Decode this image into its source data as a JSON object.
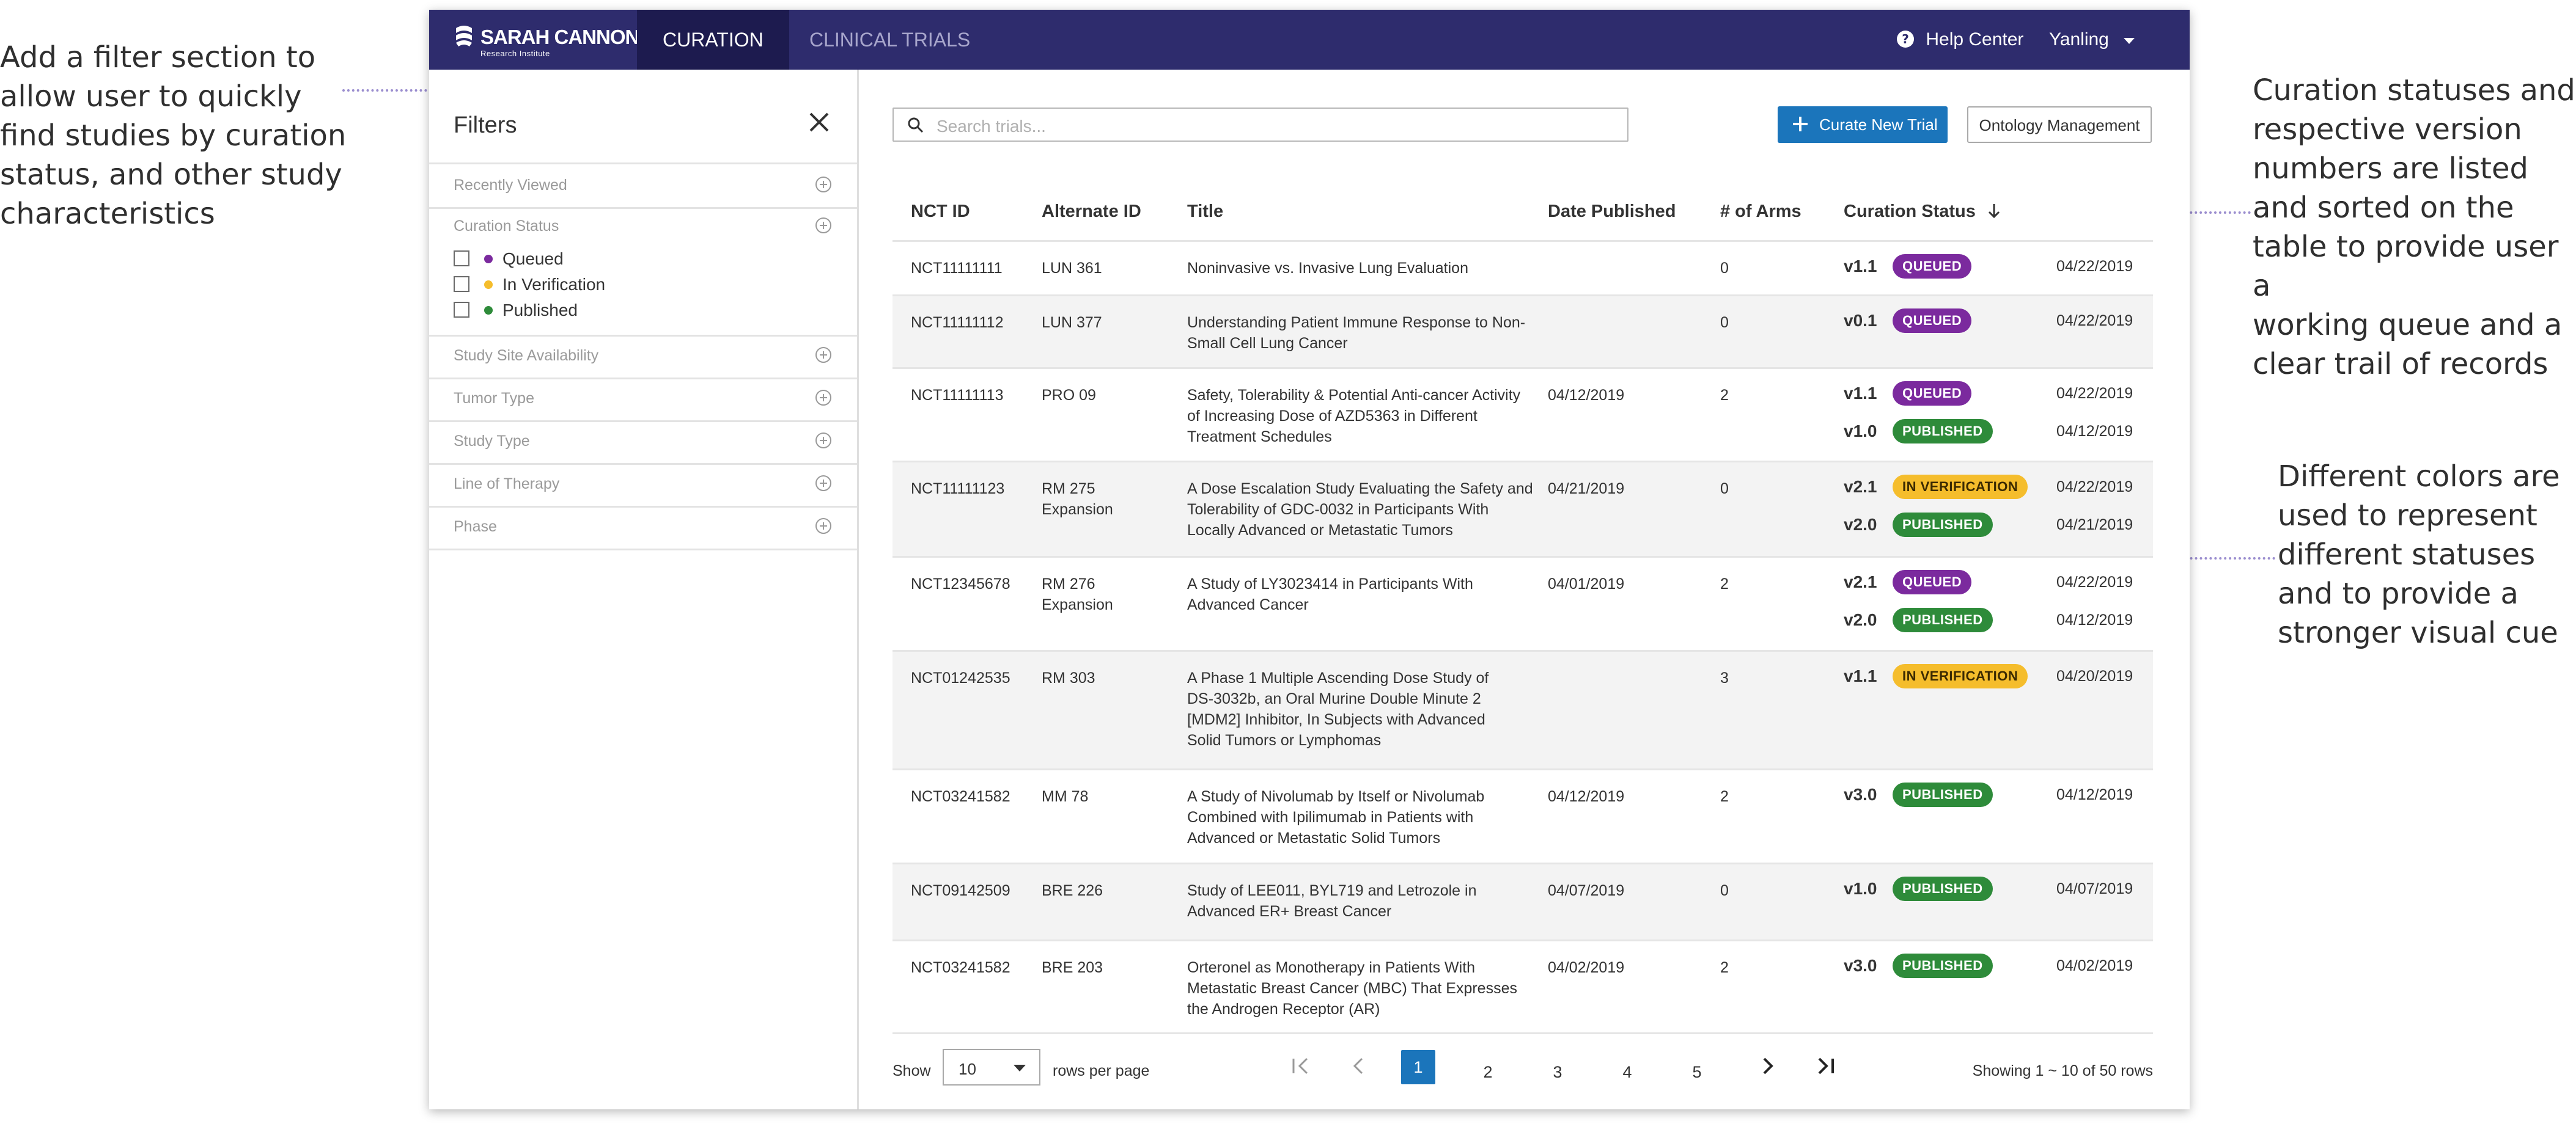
{
  "annotations": {
    "left": "Add a filter section to\nallow user to quickly\nfind studies by curation\nstatus, and other study\ncharacteristics",
    "right_top": "Curation statuses and\nrespective version\nnumbers are listed\nand sorted on the\ntable to provide user a\nworking queue and a\nclear trail of records",
    "right_bottom": "Different colors are\nused to represent\ndifferent statuses\nand to provide a\nstronger visual cue"
  },
  "brand": {
    "name": "SARAH CANNON",
    "sub": "Research Institute"
  },
  "nav": {
    "tabs": [
      {
        "label": "CURATION",
        "active": true
      },
      {
        "label": "CLINICAL TRIALS",
        "active": false
      }
    ],
    "help": "Help Center",
    "user": "Yanling"
  },
  "filters": {
    "title": "Filters",
    "sections": [
      "Recently Viewed",
      "Curation Status",
      "Study Site Availability",
      "Tumor Type",
      "Study Type",
      "Line of Therapy",
      "Phase"
    ],
    "curation_options": [
      {
        "label": "Queued",
        "color": "#7b2a9e"
      },
      {
        "label": "In Verification",
        "color": "#f5bd2c"
      },
      {
        "label": "Published",
        "color": "#2e8b3a"
      }
    ]
  },
  "toolbar": {
    "search_placeholder": "Search trials...",
    "curate_label": "Curate New Trial",
    "ontology_label": "Ontology Management"
  },
  "table": {
    "headers": [
      "NCT ID",
      "Alternate ID",
      "Title",
      "Date Published",
      "# of Arms",
      "Curation Status"
    ],
    "rows": [
      {
        "nct": "NCT11111111",
        "alt": "LUN 361",
        "title": "Noninvasive vs. Invasive Lung Evaluation",
        "published": "",
        "arms": "0",
        "versions": [
          {
            "v": "v1.1",
            "status": "QUEUED",
            "date": "04/22/2019"
          }
        ]
      },
      {
        "nct": "NCT11111112",
        "alt": "LUN 377",
        "title": "Understanding Patient Immune Response to Non-Small Cell Lung Cancer",
        "published": "",
        "arms": "0",
        "versions": [
          {
            "v": "v0.1",
            "status": "QUEUED",
            "date": "04/22/2019"
          }
        ]
      },
      {
        "nct": "NCT11111113",
        "alt": "PRO 09",
        "title": "Safety, Tolerability & Potential Anti-cancer Activity of Increasing Dose of AZD5363 in Different Treatment Schedules",
        "published": "04/12/2019",
        "arms": "2",
        "versions": [
          {
            "v": "v1.1",
            "status": "QUEUED",
            "date": "04/22/2019"
          },
          {
            "v": "v1.0",
            "status": "PUBLISHED",
            "date": "04/12/2019"
          }
        ]
      },
      {
        "nct": "NCT11111123",
        "alt": "RM 275 Expansion",
        "title": "A Dose Escalation Study Evaluating the Safety and Tolerability of GDC-0032 in Participants With Locally Advanced or Metastatic Tumors",
        "published": "04/21/2019",
        "arms": "0",
        "versions": [
          {
            "v": "v2.1",
            "status": "IN VERIFICATION",
            "date": "04/22/2019"
          },
          {
            "v": "v2.0",
            "status": "PUBLISHED",
            "date": "04/21/2019"
          }
        ]
      },
      {
        "nct": "NCT12345678",
        "alt": "RM 276 Expansion",
        "title": "A Study of LY3023414 in Participants With Advanced Cancer",
        "published": "04/01/2019",
        "arms": "2",
        "versions": [
          {
            "v": "v2.1",
            "status": "QUEUED",
            "date": "04/22/2019"
          },
          {
            "v": "v2.0",
            "status": "PUBLISHED",
            "date": "04/12/2019"
          }
        ]
      },
      {
        "nct": "NCT01242535",
        "alt": "RM 303",
        "title": "A Phase 1 Multiple Ascending Dose Study of DS-3032b, an Oral Murine Double Minute 2 [MDM2] Inhibitor, In Subjects with Advanced Solid Tumors or Lymphomas",
        "published": "",
        "arms": "3",
        "versions": [
          {
            "v": "v1.1",
            "status": "IN VERIFICATION",
            "date": "04/20/2019"
          }
        ]
      },
      {
        "nct": "NCT03241582",
        "alt": "MM 78",
        "title": "A Study of Nivolumab by Itself or Nivolumab Combined with Ipilimumab in Patients with Advanced or Metastatic Solid Tumors",
        "published": "04/12/2019",
        "arms": "2",
        "versions": [
          {
            "v": "v3.0",
            "status": "PUBLISHED",
            "date": "04/12/2019"
          }
        ]
      },
      {
        "nct": "NCT09142509",
        "alt": "BRE 226",
        "title": "Study of LEE011, BYL719 and Letrozole in Advanced ER+ Breast Cancer",
        "published": "04/07/2019",
        "arms": "0",
        "versions": [
          {
            "v": "v1.0",
            "status": "PUBLISHED",
            "date": "04/07/2019"
          }
        ]
      },
      {
        "nct": "NCT03241582",
        "alt": "BRE 203",
        "title": "Orteronel as Monotherapy in Patients With Metastatic Breast Cancer (MBC) That Expresses the Androgen Receptor (AR)",
        "published": "04/02/2019",
        "arms": "2",
        "versions": [
          {
            "v": "v3.0",
            "status": "PUBLISHED",
            "date": "04/02/2019"
          }
        ]
      }
    ]
  },
  "pagination": {
    "show": "Show",
    "rows_per_page_value": "10",
    "rows_per_page_label": "rows per page",
    "pages": [
      "1",
      "2",
      "3",
      "4",
      "5"
    ],
    "current": "1",
    "showing": "Showing 1 ~ 10 of 50 rows"
  }
}
